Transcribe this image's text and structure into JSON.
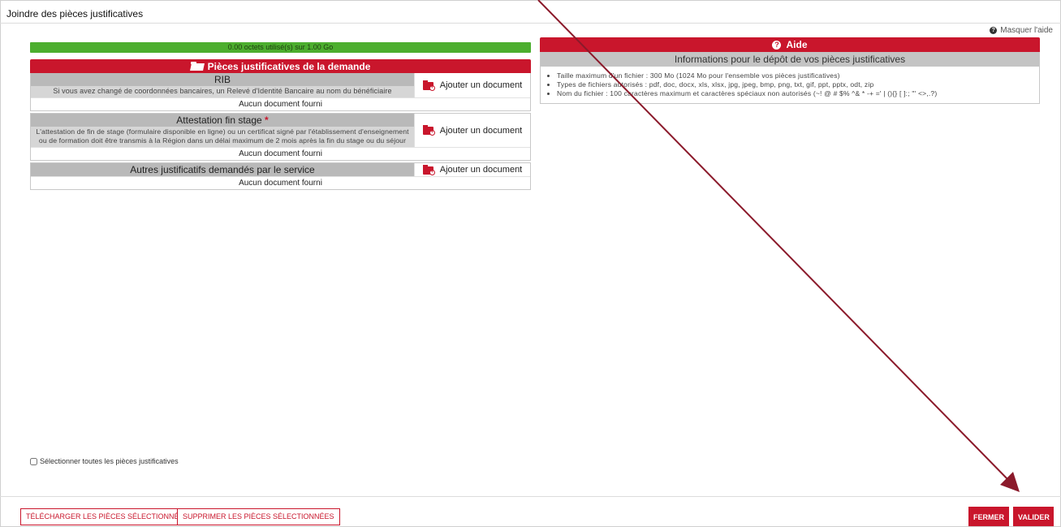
{
  "dialog": {
    "title": "Joindre des pièces justificatives"
  },
  "help_toggle": {
    "label": "Masquer l'aide",
    "icon": "question-circle-icon"
  },
  "quota": {
    "text": "0.00 octets utilisé(s) sur 1.00 Go",
    "color": "#4cae2e"
  },
  "documents_section": {
    "title": "Pièces justificatives de la demande",
    "icon": "folder-open-icon",
    "add_label": "Ajouter un document",
    "items": [
      {
        "name": "RIB",
        "required": false,
        "description": "Si vous avez changé de coordonnées bancaires, un Relevé d'Identité Bancaire au nom du bénéficiaire",
        "status": "Aucun document fourni"
      },
      {
        "name": "Attestation fin stage",
        "required": true,
        "required_mark": "*",
        "description": "L'attestation de fin de stage (formulaire disponible en ligne) ou un certificat signé par l'établissement d'enseignement ou de formation doit être transmis à la Région dans un délai maximum de 2 mois après la fin du stage ou du séjour",
        "status": "Aucun document fourni"
      },
      {
        "name": "Autres justificatifs demandés par le service",
        "required": false,
        "description": "",
        "status": "Aucun document fourni"
      }
    ]
  },
  "aide": {
    "title": "Aide",
    "subtitle": "Informations pour le dépôt de vos pièces justificatives",
    "items": [
      "Taille maximum d'un fichier : 300 Mo (1024 Mo pour l'ensemble vos pièces justificatives)",
      "Types de fichiers autorisés : pdf, doc, docx, xls, xlsx, jpg, jpeg, bmp, png, txt, gif, ppt, pptx, odt, zip",
      "Nom du fichier : 100 caractères maximum et caractères spéciaux non autorisés (~! @ # $% ^& * -+ =' | (){} [ ]:; \"' <>,.?)"
    ]
  },
  "select_all": {
    "label": "Sélectionner toutes les pièces justificatives",
    "checked": false
  },
  "footer": {
    "download_label": "TÉLÉCHARGER LES PIÈCES SÉLECTIONNÉES",
    "delete_label": "SUPPRIMER LES PIÈCES SÉLECTIONNÉES",
    "close_label": "FERMER",
    "validate_label": "VALIDER"
  },
  "colors": {
    "accent": "#c9162c",
    "success": "#4cae2e",
    "annotation_arrow": "#8b1a2b"
  }
}
